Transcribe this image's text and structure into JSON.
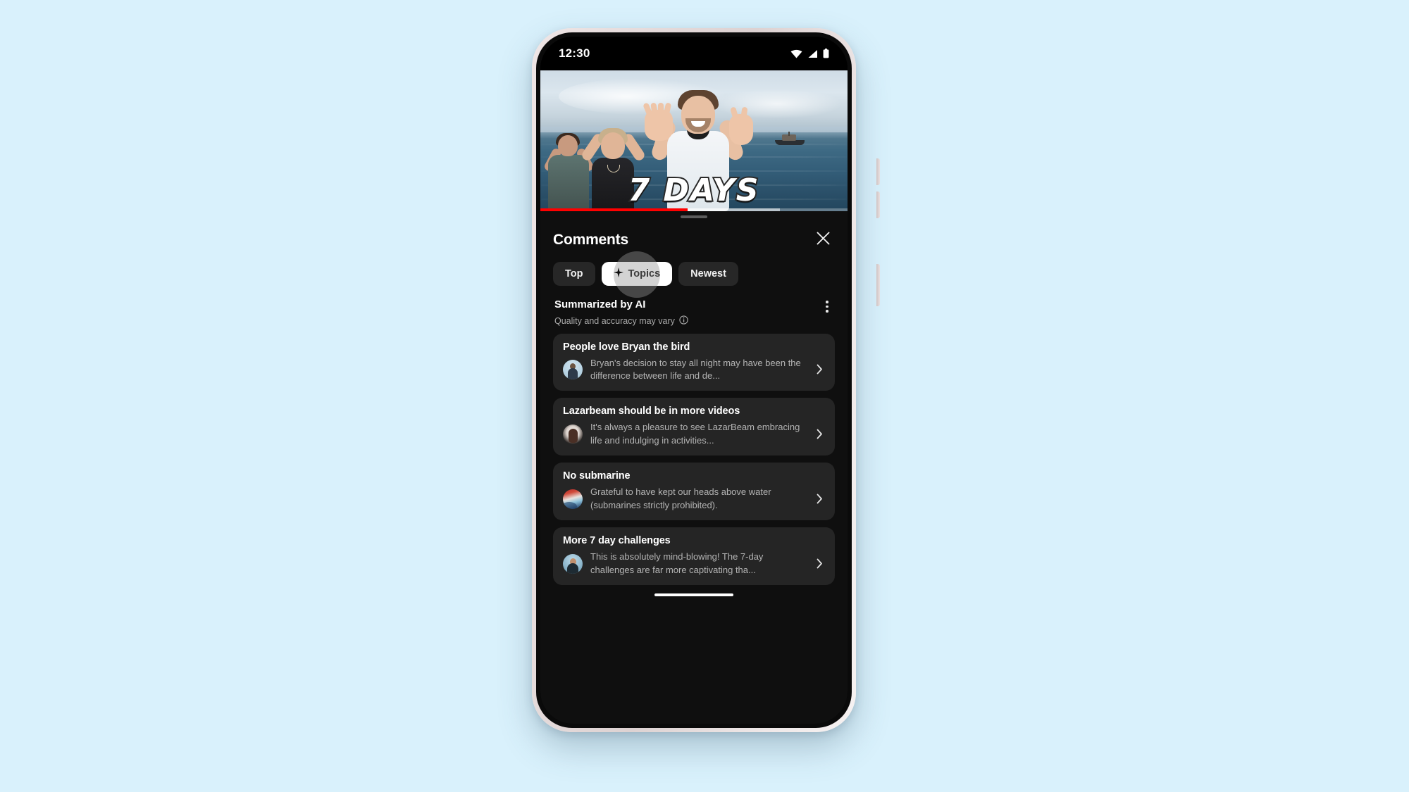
{
  "background_color": "#d9f1fc",
  "status_bar": {
    "time": "12:30",
    "icons": [
      "wifi-icon",
      "cellular-signal-icon",
      "battery-icon"
    ]
  },
  "player": {
    "overlay_text": "7 DAYS",
    "progress_percent": 48,
    "buffered_percent": 78,
    "progress_color": "#ff0000",
    "handle_name": "sheet-drag-handle"
  },
  "sheet": {
    "title": "Comments",
    "close_label": "✕",
    "filter_chips": [
      {
        "label": "Top",
        "active": false
      },
      {
        "label": "Topics",
        "active": true,
        "icon": "sparkle-icon",
        "pressed": true
      },
      {
        "label": "Newest",
        "active": false
      }
    ],
    "ai_section": {
      "title": "Summarized by AI",
      "subtitle": "Quality and accuracy may vary",
      "info_icon": "info-icon",
      "overflow_icon": "kebab-menu-icon"
    },
    "topics": [
      {
        "title": "People love Bryan the bird",
        "snippet": "Bryan's decision to stay all night may have been the difference between life and de...",
        "avatar": "av-1",
        "chevron": "chevron-right-icon"
      },
      {
        "title": "Lazarbeam should be in more videos",
        "snippet": "It's always a pleasure to see LazarBeam embracing life and indulging in activities...",
        "avatar": "av-2",
        "chevron": "chevron-right-icon"
      },
      {
        "title": "No submarine",
        "snippet": "Grateful to have kept our heads above water (submarines strictly prohibited).",
        "avatar": "av-3",
        "chevron": "chevron-right-icon"
      },
      {
        "title": "More 7 day challenges",
        "snippet": "This is absolutely mind-blowing! The 7-day challenges are far more captivating tha...",
        "avatar": "av-4",
        "chevron": "chevron-right-icon"
      }
    ]
  }
}
